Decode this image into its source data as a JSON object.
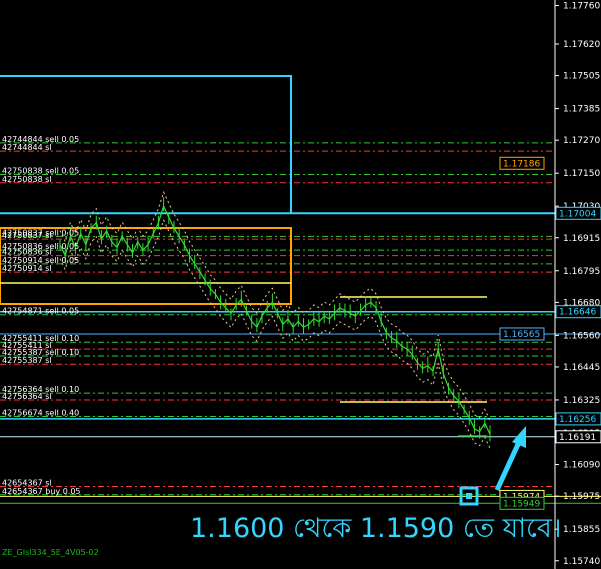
{
  "colors": {
    "background": "#000000",
    "candles": "#33dd33",
    "axis_text": "#ffffff",
    "grid_line": "#2a2a2a",
    "cyan": "#33d6ff",
    "red_level": "#ff3333",
    "green_level": "#33cc33",
    "orange": "#ffa500",
    "yellow": "#ffff66",
    "light_blue": "#4fb3ff"
  },
  "chart_data": {
    "type": "line",
    "title": "",
    "xlabel": "",
    "ylabel": "",
    "ylim": [
      1.1571,
      1.1778
    ],
    "grid": false,
    "price_axis_ticks": [
      "1.17760",
      "1.17620",
      "1.17505",
      "1.17385",
      "1.17270",
      "1.17150",
      "1.17030",
      "1.16915",
      "1.16795",
      "1.16680",
      "1.16560",
      "1.16445",
      "1.16325",
      "1.16205",
      "1.16090",
      "1.15975",
      "1.15855",
      "1.15740"
    ],
    "price_axis_values": [
      1.1776,
      1.1762,
      1.17505,
      1.17385,
      1.1727,
      1.1715,
      1.1703,
      1.16915,
      1.16795,
      1.1668,
      1.1656,
      1.16445,
      1.16325,
      1.16205,
      1.1609,
      1.15975,
      1.15855,
      1.1574
    ],
    "price_boxes": [
      {
        "text": "1.17186",
        "value": 1.17186,
        "color": "#ffa500"
      },
      {
        "text": "1.17004",
        "value": 1.17004,
        "color": "#33d6ff"
      },
      {
        "text": "1.16646",
        "value": 1.16646,
        "color": "#33d6ff"
      },
      {
        "text": "1.16565",
        "value": 1.16565,
        "color": "#4fb3ff"
      },
      {
        "text": "1.16256",
        "value": 1.16256,
        "color": "#33d6ff"
      },
      {
        "text": "1.16191",
        "value": 1.16191,
        "color": "#ffffff"
      },
      {
        "text": "1.15974",
        "value": 1.15974,
        "color": "#ffff66"
      },
      {
        "text": "1.15949",
        "value": 1.15949,
        "color": "#33cc33"
      }
    ],
    "series": [
      {
        "values": [
          1.1689,
          1.1685,
          1.1692,
          1.1688,
          1.1693,
          1.1689,
          1.1695,
          1.1697,
          1.1691,
          1.1694,
          1.169,
          1.1688,
          1.1692,
          1.1689,
          1.1686,
          1.169,
          1.1687,
          1.1689,
          1.1693,
          1.1697,
          1.1703,
          1.1699,
          1.1695,
          1.1692,
          1.1689,
          1.1685,
          1.1682,
          1.1679,
          1.1676,
          1.1673,
          1.1671,
          1.1668,
          1.1666,
          1.1664,
          1.1667,
          1.1669,
          1.1665,
          1.1661,
          1.1659,
          1.1663,
          1.1666,
          1.1668,
          1.1664,
          1.166,
          1.1662,
          1.1659,
          1.1661,
          1.1659,
          1.166,
          1.1662,
          1.1661,
          1.1663,
          1.1662,
          1.1664,
          1.1666,
          1.1665,
          1.1664,
          1.1663,
          1.1665,
          1.1667,
          1.1668,
          1.1666,
          1.1661,
          1.1657,
          1.1655,
          1.1654,
          1.1652,
          1.1651,
          1.1649,
          1.1646,
          1.1644,
          1.1645,
          1.1643,
          1.1651,
          1.1642,
          1.1637,
          1.1634,
          1.1632,
          1.1629,
          1.1626,
          1.1622,
          1.1621,
          1.1624,
          1.162
        ]
      }
    ]
  },
  "orders": [
    {
      "text": "42744844 sell 0.05",
      "value": 1.1726,
      "color": "#33cc33"
    },
    {
      "text": "42744844 sl",
      "value": 1.1723,
      "color": "#ff3333"
    },
    {
      "text": "42750838 sell 0.05",
      "value": 1.17145,
      "color": "#33cc33"
    },
    {
      "text": "42750838 sl",
      "value": 1.17115,
      "color": "#ff3333"
    },
    {
      "text": "42750837 sell 0.05",
      "value": 1.1692,
      "color": "#33cc33"
    },
    {
      "text": "42750837 sl",
      "value": 1.1691,
      "color": "#ff3333"
    },
    {
      "text": "42750836 sell 0.05",
      "value": 1.1687,
      "color": "#33cc33"
    },
    {
      "text": "42750836 sl",
      "value": 1.1685,
      "color": "#ff3333"
    },
    {
      "text": "42750914 sell 0.05",
      "value": 1.1682,
      "color": "#33cc33"
    },
    {
      "text": "42750914 sl",
      "value": 1.1679,
      "color": "#ff3333"
    },
    {
      "text": "42754871 sell 0.05",
      "value": 1.16635,
      "color": "#33cc33"
    },
    {
      "text": "42755411 sell 0.10",
      "value": 1.16535,
      "color": "#33cc33"
    },
    {
      "text": "42755411 sl",
      "value": 1.1651,
      "color": "#ff3333"
    },
    {
      "text": "42755387 sell 0.10",
      "value": 1.16485,
      "color": "#33cc33"
    },
    {
      "text": "42755387 sl",
      "value": 1.16455,
      "color": "#ff3333"
    },
    {
      "text": "42756364 sell 0.10",
      "value": 1.1635,
      "color": "#33cc33"
    },
    {
      "text": "42756364 sl",
      "value": 1.16325,
      "color": "#ff3333"
    },
    {
      "text": "42756674 sell 0.40",
      "value": 1.16265,
      "color": "#33cc33"
    },
    {
      "text": "42654367 sl",
      "value": 1.1601,
      "color": "#ff3333"
    },
    {
      "text": "42654367 buy 0.05",
      "value": 1.1598,
      "color": "#33cc33"
    }
  ],
  "annotation": "1.1600 থেকে 1.1590 তে যাবে।",
  "symbol_label": "ZE_GIsl334_5E_4V05-02"
}
